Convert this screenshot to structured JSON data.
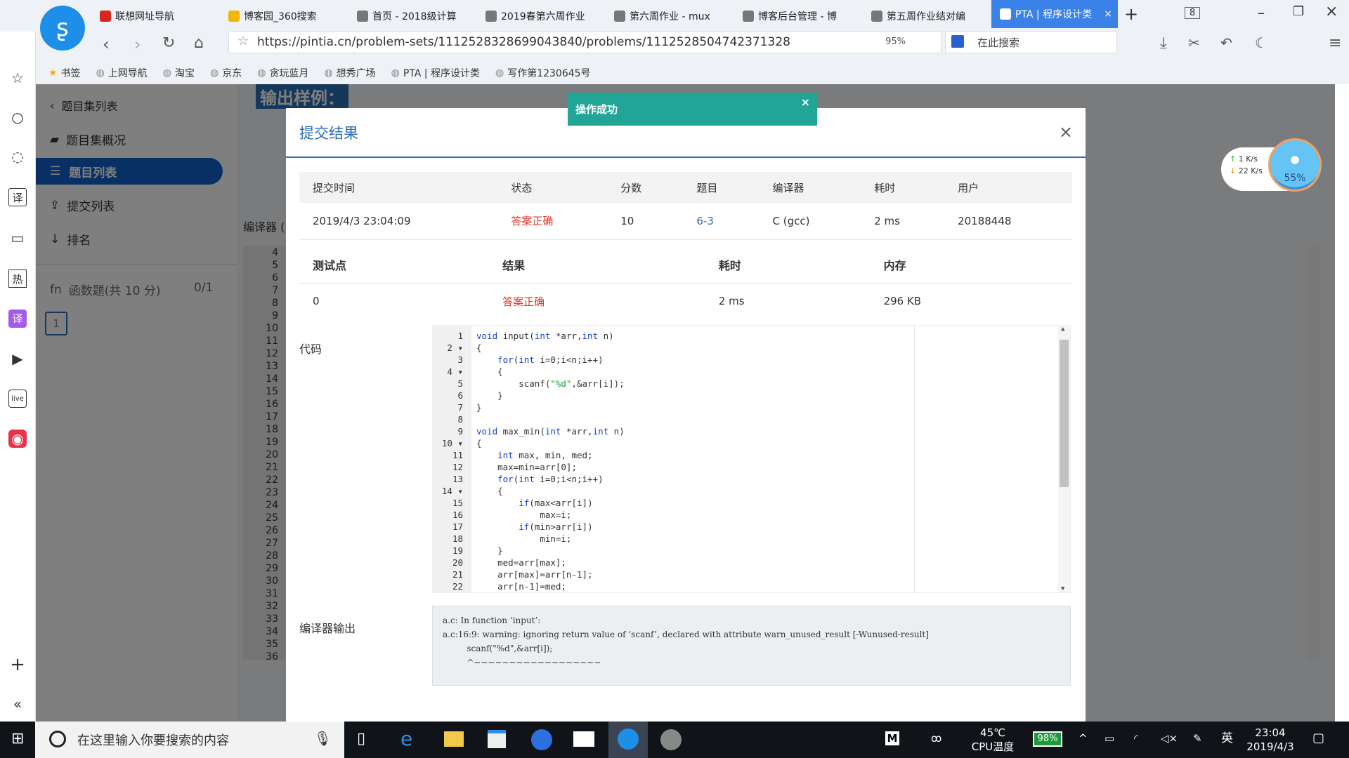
{
  "browser": {
    "tabs": [
      {
        "label": "联想网址导航",
        "color": "#d9261c"
      },
      {
        "label": "博客园_360搜索",
        "color": "#f2b705"
      },
      {
        "label": "首页 - 2018级计算",
        "color": "#777"
      },
      {
        "label": "2019春第六周作业",
        "color": "#777"
      },
      {
        "label": "第六周作业 - mux",
        "color": "#777"
      },
      {
        "label": "博客后台管理 - 博",
        "color": "#777"
      },
      {
        "label": "第五周作业结对编",
        "color": "#777"
      },
      {
        "label": "PTA | 程序设计类",
        "color": "#fff"
      }
    ],
    "tab_count": "8",
    "url": "https://pintia.cn/problem-sets/1112528328699043840/problems/1112528504742371328",
    "zoom": "95%",
    "search_placeholder": "在此搜索",
    "bookmarks": [
      "书签",
      "上网导航",
      "淘宝",
      "京东",
      "贪玩蓝月",
      "想秀广场",
      "PTA | 程序设计类",
      "写作第1230645号"
    ]
  },
  "sidebar": {
    "back": "题目集列表",
    "items": [
      "题目集概况",
      "题目列表",
      "提交列表",
      "排名"
    ],
    "active": "题目列表",
    "section": "函数题(共 10 分)",
    "section_score": "0/1",
    "problem_box": "1",
    "bg_compiler_label": "编译器 (",
    "bg_heading": "输出样例："
  },
  "toast": {
    "text": "操作成功",
    "close": "×",
    "color": "#20a597"
  },
  "modal": {
    "title": "提交结果",
    "close": "×",
    "summary": {
      "headers": [
        "提交时间",
        "状态",
        "分数",
        "题目",
        "编译器",
        "耗时",
        "用户"
      ],
      "row": [
        "2019/4/3 23:04:09",
        "答案正确",
        "10",
        "6-3",
        "C (gcc)",
        "2 ms",
        "20188448"
      ]
    },
    "tests": {
      "headers": [
        "测试点",
        "结果",
        "耗时",
        "内存"
      ],
      "row": [
        "0",
        "答案正确",
        "2 ms",
        "296 KB"
      ]
    },
    "code_label": "代码",
    "code": [
      "void input(int *arr,int n)",
      "{",
      "    for(int i=0;i<n;i++)",
      "    {",
      "        scanf(\"%d\",&arr[i]);",
      "    }",
      "}",
      "",
      "void max_min(int *arr,int n)",
      "{",
      "    int max, min, med;",
      "    max=min=arr[0];",
      "    for(int i=0;i<n;i++)",
      "    {",
      "        if(max<arr[i])",
      "            max=i;",
      "        if(min>arr[i])",
      "            min=i;",
      "    }",
      "    med=arr[max];",
      "    arr[max]=arr[n-1];",
      "    arr[n-1]=med;"
    ],
    "fold_lines": [
      2,
      4,
      10,
      14
    ],
    "compiler_label": "编译器输出",
    "compiler_output": "a.c: In function ‘input’:\na.c:16:9: warning: ignoring return value of ‘scanf’, declared with attribute warn_unused_result [-Wunused-result]\n         scanf(\"%d\",&arr[i]);\n         ^~~~~~~~~~~~~~~~~~~"
  },
  "net": {
    "up": "1   K/s",
    "down": "22  K/s",
    "percent": "55%"
  },
  "taskbar": {
    "search_placeholder": "在这里输入你要搜索的内容",
    "temp": "45℃",
    "temp_label": "CPU温度",
    "battery": "98%",
    "ime": "英",
    "time": "23:04",
    "date": "2019/4/3"
  }
}
